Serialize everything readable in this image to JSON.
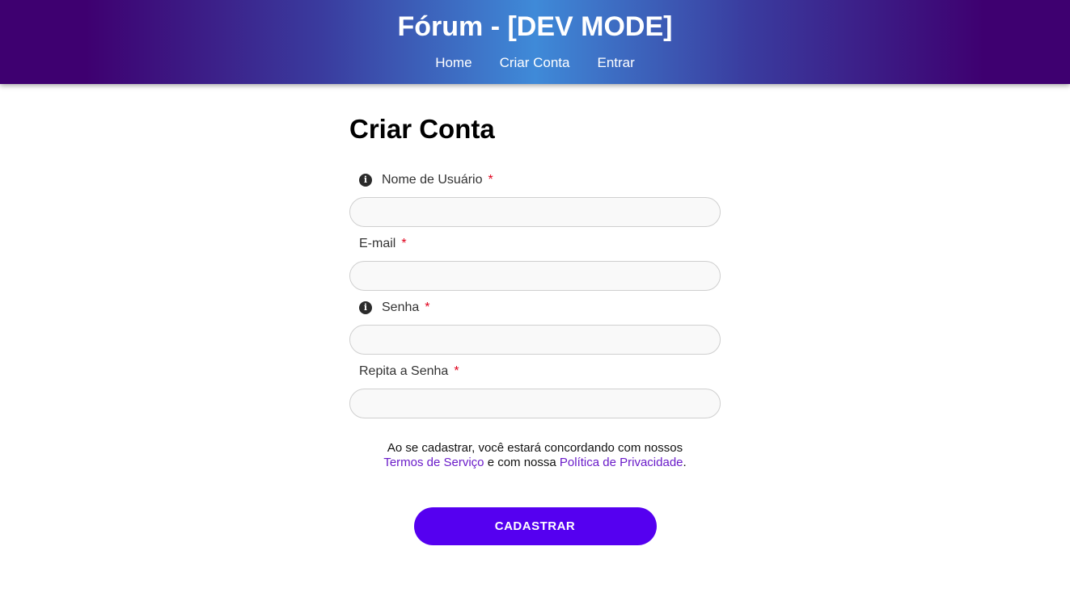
{
  "header": {
    "title": "Fórum - [DEV MODE]",
    "nav": [
      {
        "label": "Home"
      },
      {
        "label": "Criar Conta"
      },
      {
        "label": "Entrar"
      }
    ]
  },
  "form": {
    "title": "Criar Conta",
    "fields": [
      {
        "label": "Nome de Usuário",
        "required": "*",
        "value": "",
        "placeholder": ""
      },
      {
        "label": "E-mail",
        "required": "*",
        "value": "",
        "placeholder": ""
      },
      {
        "label": "Senha",
        "required": "*",
        "value": "",
        "placeholder": ""
      },
      {
        "label": "Repita a Senha",
        "required": "*",
        "value": "",
        "placeholder": ""
      }
    ],
    "info_icon_glyph": "i",
    "terms": {
      "text_before": "Ao se cadastrar, você estará concordando com nossos",
      "terms_link": "Termos de Serviço",
      "text_middle": " e com nossa ",
      "privacy_link": "Política de Privacidade",
      "text_end": "."
    },
    "submit_label": "CADASTRAR"
  },
  "colors": {
    "accent": "#5500f0",
    "link": "#6a1bc9",
    "required": "#e0001b"
  }
}
